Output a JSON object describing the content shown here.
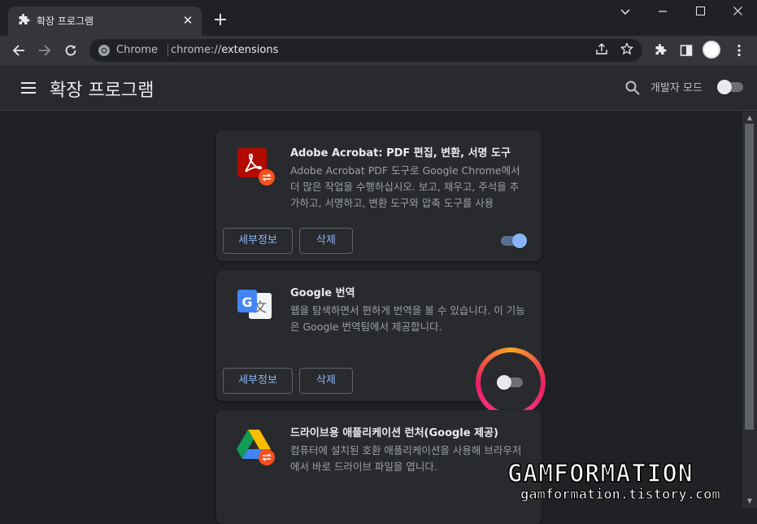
{
  "tab": {
    "title": "확장 프로그램",
    "icon": "puzzle-icon",
    "close": "✕"
  },
  "newtab": "+",
  "window_controls": {
    "dropdown": "⌄",
    "minimize": "—",
    "maximize": "☐",
    "close": "✕"
  },
  "omnibox": {
    "host": "Chrome",
    "url_prefix": "chrome://",
    "url_path": "extensions"
  },
  "header": {
    "title": "확장 프로그램",
    "dev_mode_label": "개발자 모드",
    "dev_mode_enabled": false
  },
  "extensions": [
    {
      "name": "Adobe Acrobat: PDF 편집, 변환, 서명 도구",
      "description": "Adobe Acrobat PDF 도구로 Google Chrome에서 더 많은 작업을 수행하십시오. 보고, 채우고, 주석을 추가하고, 서명하고, 변환 도구와 압축 도구를 사용",
      "details_label": "세부정보",
      "remove_label": "삭제",
      "enabled": true,
      "icon": "adobe-acrobat-icon"
    },
    {
      "name": "Google 번역",
      "description": "웹을 탐색하면서 편하게 번역을 볼 수 있습니다. 이 기능은 Google 번역팀에서 제공합니다.",
      "details_label": "세부정보",
      "remove_label": "삭제",
      "enabled": false,
      "icon": "google-translate-icon"
    },
    {
      "name": "드라이브용 애플리케이션 런처(Google 제공)",
      "description": "컴퓨터에 설치된 호환 애플리케이션을 사용해 브라우저에서 바로 드라이브 파일을 엽니다.",
      "icon": "google-drive-icon"
    }
  ],
  "watermark": {
    "title": "GAMFORMATION",
    "url": "gamformation.tistory.com"
  },
  "colors": {
    "accent": "#8ab4f8",
    "background": "#202124",
    "card": "#292a2d",
    "highlight": "#e91e63"
  }
}
